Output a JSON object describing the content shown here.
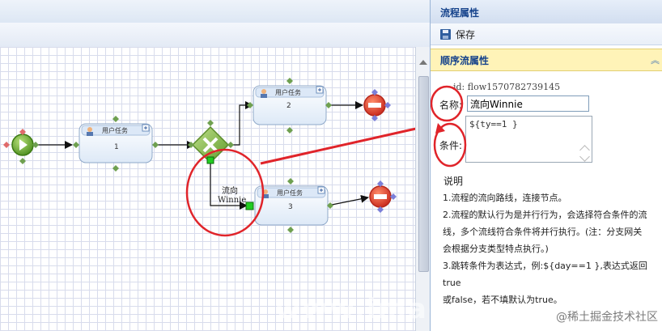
{
  "designer": {
    "tasks": [
      {
        "id": "task1",
        "header": "用户任务",
        "number": "1"
      },
      {
        "id": "task2",
        "header": "用户任务",
        "number": "2"
      },
      {
        "id": "task3",
        "header": "用户任务",
        "number": "3"
      }
    ],
    "flow_label": {
      "line1": "流向",
      "line2": "Winnie"
    },
    "annotation_color": "#e0242a",
    "flow_color": "#111111"
  },
  "panel": {
    "title": "流程属性",
    "save_label": "保存",
    "section_title": "顺序流属性",
    "id_label": "id:",
    "id_value": "flow1570782739145",
    "name_label": "名称:",
    "name_value": "流向Winnie",
    "condition_label": "条件:",
    "condition_value": "${ty==1 }",
    "description_title": "说明",
    "description_lines": [
      "1.流程的流向路线，连接节点。",
      "2.流程的默认行为是并行行为，会选择符合条件的流",
      "线，多个流线符合条件将并行执行。(注：分支网关",
      "会根据分支类型特点执行。)",
      "3.跳转条件为表达式，例:${day==1 },表达式返回true",
      "或false，若不填默认为true。"
    ]
  },
  "watermark": "@稀土掘金技术社区"
}
